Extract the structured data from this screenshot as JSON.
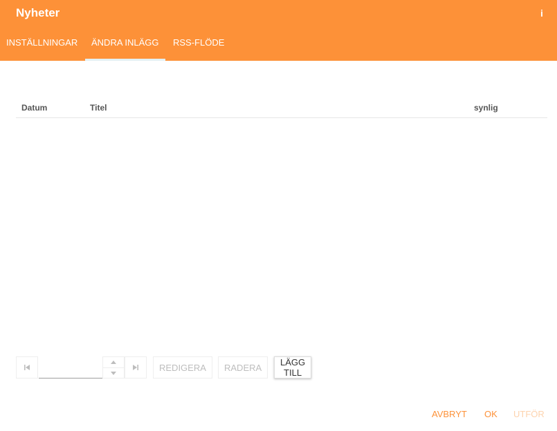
{
  "header": {
    "title": "Nyheter",
    "info_icon": "info-icon",
    "background_color": "#fd9138",
    "tabs": [
      {
        "label": "INSTÄLLNINGAR",
        "active": false
      },
      {
        "label": "ÄNDRA INLÄGG",
        "active": true
      },
      {
        "label": "RSS-FLÖDE",
        "active": false
      }
    ]
  },
  "table": {
    "columns": [
      "Datum",
      "Titel",
      "synlig"
    ],
    "rows": []
  },
  "pager": {
    "first_icon": "first-page-icon",
    "last_icon": "last-page-icon",
    "page_value": "",
    "spin_up_icon": "spin-up-icon",
    "spin_down_icon": "spin-down-icon"
  },
  "actions": {
    "edit_label": "REDIGERA",
    "delete_label": "RADERA",
    "add_label": "LÄGG TILL"
  },
  "footer": {
    "cancel_label": "AVBRYT",
    "ok_label": "OK",
    "apply_label": "UTFÖR"
  }
}
